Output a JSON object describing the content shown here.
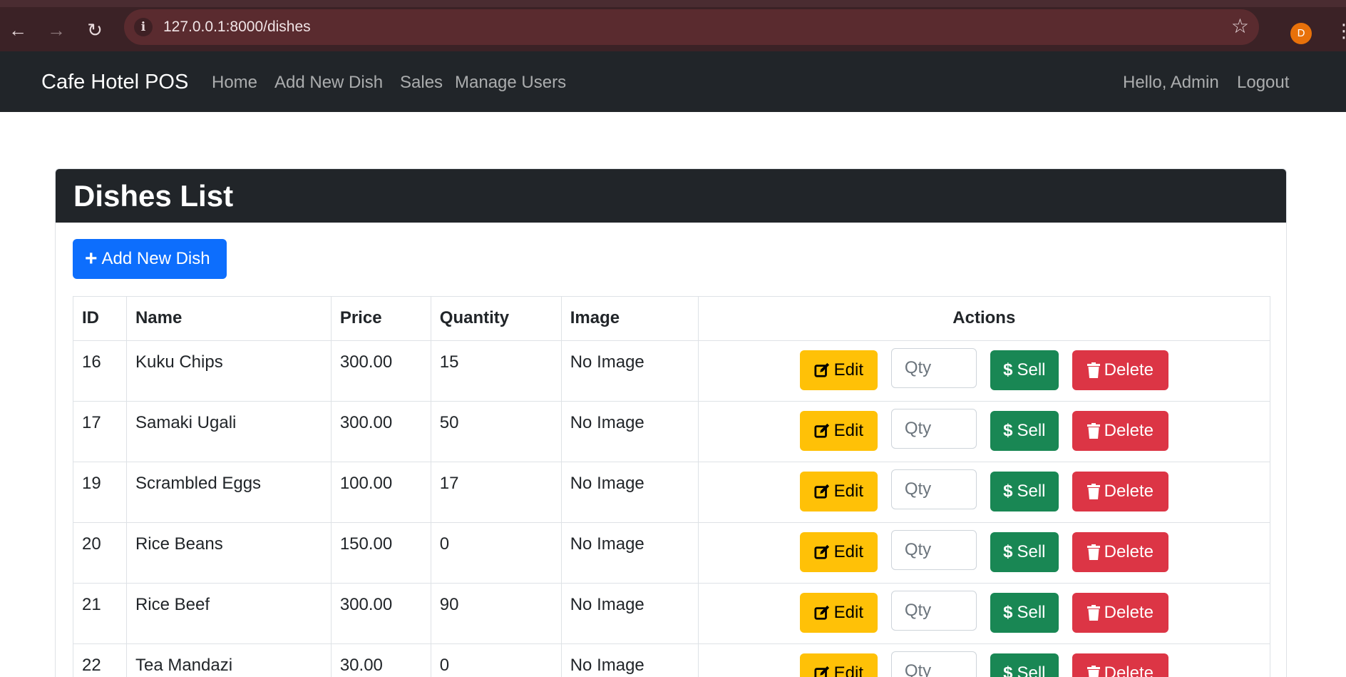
{
  "browser": {
    "url": "127.0.0.1:8000/dishes",
    "profile_initial": "D"
  },
  "navbar": {
    "brand": "Cafe Hotel POS",
    "links": [
      "Home",
      "Add New Dish",
      "Sales",
      "Manage Users"
    ],
    "greeting": "Hello, Admin",
    "logout": "Logout"
  },
  "card": {
    "title": "Dishes List",
    "add_button": "Add New Dish"
  },
  "table": {
    "headers": [
      "ID",
      "Name",
      "Price",
      "Quantity",
      "Image",
      "Actions"
    ],
    "rows": [
      {
        "id": "16",
        "name": "Kuku Chips",
        "price": "300.00",
        "quantity": "15",
        "image": "No Image"
      },
      {
        "id": "17",
        "name": "Samaki Ugali",
        "price": "300.00",
        "quantity": "50",
        "image": "No Image"
      },
      {
        "id": "19",
        "name": "Scrambled Eggs",
        "price": "100.00",
        "quantity": "17",
        "image": "No Image"
      },
      {
        "id": "20",
        "name": "Rice Beans",
        "price": "150.00",
        "quantity": "0",
        "image": "No Image"
      },
      {
        "id": "21",
        "name": "Rice Beef",
        "price": "300.00",
        "quantity": "90",
        "image": "No Image"
      },
      {
        "id": "22",
        "name": "Tea Mandazi",
        "price": "30.00",
        "quantity": "0",
        "image": "No Image"
      }
    ],
    "actions": {
      "edit": "Edit",
      "qty_placeholder": "Qty",
      "sell": "Sell",
      "delete": "Delete"
    }
  },
  "colors": {
    "primary": "#0d6efd",
    "warning": "#ffc107",
    "success": "#198754",
    "danger": "#dc3545",
    "dark": "#212529"
  }
}
